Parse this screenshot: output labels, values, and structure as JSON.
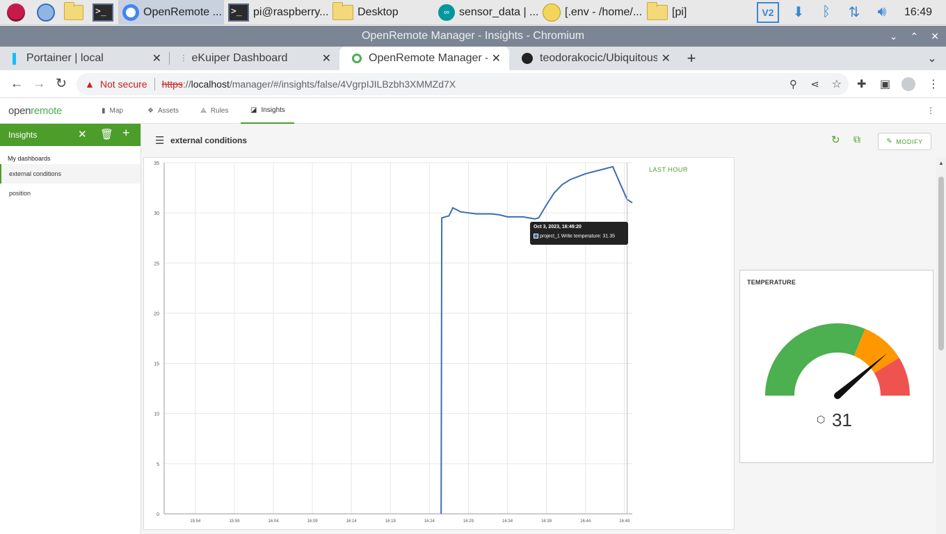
{
  "taskbar": {
    "items": [
      {
        "label": "OpenRemote ...",
        "icon": "chromium-icon"
      },
      {
        "label": "pi@raspberry...",
        "icon": "terminal-icon"
      },
      {
        "label": "Desktop",
        "icon": "folder-icon"
      },
      {
        "label": "sensor_data | ...",
        "icon": "arduino-icon"
      },
      {
        "label": "[.env - /home/...",
        "icon": "mousepad-icon"
      },
      {
        "label": "[pi]",
        "icon": "folder-icon"
      }
    ],
    "clock": "16:49"
  },
  "window": {
    "title": "OpenRemote Manager - Insights - Chromium"
  },
  "tabs": [
    {
      "label": "Portainer | local"
    },
    {
      "label": "eKuiper Dashboard"
    },
    {
      "label": "OpenRemote Manager - Insights"
    },
    {
      "label": "teodorakocic/Ubiquitous"
    }
  ],
  "address": {
    "warning": "Not secure",
    "scheme": "https",
    "sep": "://",
    "host": "localhost",
    "path": "/manager/#/insights/false/4VgrpIJILBzbh3XMMZd7X"
  },
  "app": {
    "logo_a": "open",
    "logo_b": "remote",
    "menu": [
      {
        "label": "Map"
      },
      {
        "label": "Assets"
      },
      {
        "label": "Rules"
      },
      {
        "label": "Insights"
      }
    ]
  },
  "sidebar": {
    "title": "Insights",
    "section": "My dashboards",
    "items": [
      {
        "label": "external conditions"
      },
      {
        "label": "position"
      }
    ]
  },
  "dashboard": {
    "title": "external conditions",
    "modify": "MODIFY",
    "period": "LAST HOUR"
  },
  "tooltip": {
    "date": "Oct 3, 2023, 16:49:20",
    "text": "project_1 Write temperature: 31.35"
  },
  "gauge": {
    "title": "TEMPERATURE",
    "value": "31",
    "min": 0,
    "max": 40,
    "needle": 31,
    "bands": [
      {
        "from": 0,
        "to": 25,
        "color": "#4caf50"
      },
      {
        "from": 25,
        "to": 33,
        "color": "#ff9800"
      },
      {
        "from": 33,
        "to": 40,
        "color": "#ef5350"
      }
    ]
  },
  "chart_data": {
    "type": "line",
    "title": "",
    "xlabel": "",
    "ylabel": "",
    "x_ticks": [
      "15:54",
      "15:59",
      "16:04",
      "16:09",
      "16:14",
      "16:19",
      "16:24",
      "16:29",
      "16:34",
      "16:39",
      "16:44",
      "16:49"
    ],
    "y_ticks": [
      0,
      5,
      10,
      15,
      20,
      25,
      30,
      35
    ],
    "ylim": [
      0,
      35
    ],
    "xlim_minutes": [
      "15:50",
      "16:50"
    ],
    "grid": true,
    "series": [
      {
        "color": "#3d6db5",
        "points": [
          [
            "16:25:30",
            0
          ],
          [
            "16:25:35",
            29.5
          ],
          [
            "16:26:00",
            29.6
          ],
          [
            "16:26:30",
            29.7
          ],
          [
            "16:27:00",
            30.5
          ],
          [
            "16:28:00",
            30.1
          ],
          [
            "16:30:00",
            29.9
          ],
          [
            "16:32:00",
            29.9
          ],
          [
            "16:33:00",
            29.8
          ],
          [
            "16:34:00",
            29.6
          ],
          [
            "16:36:00",
            29.6
          ],
          [
            "16:37:30",
            29.4
          ],
          [
            "16:38:00",
            29.5
          ],
          [
            "16:39:00",
            30.8
          ],
          [
            "16:40:00",
            32.0
          ],
          [
            "16:41:00",
            32.8
          ],
          [
            "16:42:00",
            33.3
          ],
          [
            "16:43:00",
            33.6
          ],
          [
            "16:44:00",
            33.9
          ],
          [
            "16:45:00",
            34.1
          ],
          [
            "16:46:00",
            34.3
          ],
          [
            "16:47:00",
            34.5
          ],
          [
            "16:47:30",
            34.6
          ],
          [
            "16:48:30",
            32.8
          ],
          [
            "16:49:20",
            31.35
          ],
          [
            "16:50:00",
            31.0
          ]
        ]
      }
    ]
  }
}
